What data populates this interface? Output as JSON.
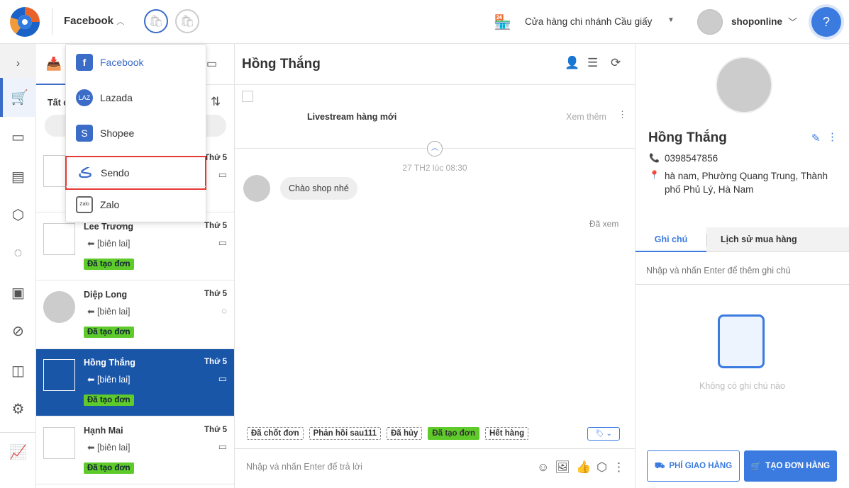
{
  "header": {
    "channel": "Facebook",
    "store": "Cửa hàng chi nhánh Cầu giấy",
    "user": "shoponline"
  },
  "dropdown": {
    "options": [
      "Facebook",
      "Lazada",
      "Shopee",
      "Sendo",
      "Zalo"
    ],
    "highlighted": "Sendo"
  },
  "list": {
    "filter_label": "Tất c",
    "conversations": [
      {
        "name": "",
        "day": "Thứ 5",
        "preview": "",
        "badge": ""
      },
      {
        "name": "Lee Trương",
        "day": "Thứ 5",
        "preview": "[biên lai]",
        "badge": "Đã tạo đơn"
      },
      {
        "name": "Diệp Long",
        "day": "Thứ 5",
        "preview": "[biên lai]",
        "badge": "Đã tạo đơn"
      },
      {
        "name": "Hồng Thắng",
        "day": "Thứ 5",
        "preview": "[biên lai]",
        "badge": "Đã tạo đơn"
      },
      {
        "name": "Hạnh Mai",
        "day": "Thứ 5",
        "preview": "[biên lai]",
        "badge": "Đã tạo đơn"
      }
    ]
  },
  "chat": {
    "title": "Hồng Thắng",
    "post_title": "Livestream hàng mới",
    "see_more": "Xem thêm",
    "date": "27 TH2 lúc 08:30",
    "message": "Chào shop nhé",
    "seen": "Đã xem",
    "tags": [
      "Đã chốt đơn",
      "Phản hồi sau111",
      "Đã hủy",
      "Đã tạo đơn",
      "Hết hàng"
    ],
    "input_placeholder": "Nhập và nhấn Enter để trả lời"
  },
  "customer": {
    "name": "Hồng Thắng",
    "phone": "0398547856",
    "address": "hà nam, Phường Quang Trung, Thành phố Phủ Lý, Hà Nam",
    "tabs": [
      "Ghi chú",
      "Lịch sử mua hàng"
    ],
    "note_placeholder": "Nhập và nhấn Enter để thêm ghi chú",
    "empty_notes": "Không có ghi chú nào",
    "btn_shipping": "PHÍ GIAO HÀNG",
    "btn_order": "TẠO ĐƠN HÀNG"
  },
  "colors": {
    "primary": "#1a56a8",
    "accent": "#3b7be0",
    "badge": "#5fcb2a",
    "highlight": "#e53935"
  }
}
